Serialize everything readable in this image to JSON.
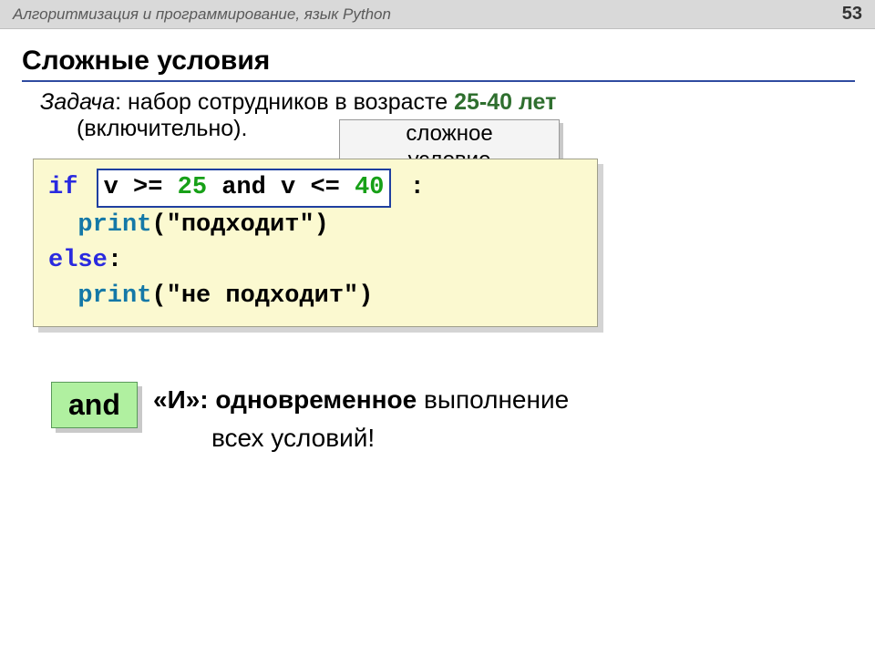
{
  "header": {
    "title": "Алгоритмизация и программирование, язык Python",
    "page": "53"
  },
  "slide_title": "Сложные условия",
  "task": {
    "label": "Задача",
    "text1": ": набор сотрудников в возрасте ",
    "ages": "25-40 лет",
    "text2": "(включительно).",
    "callout_l1": "сложное",
    "callout_l2": "условие"
  },
  "code": {
    "kw_if": "if",
    "cond": {
      "pre": "v >= ",
      "n1": "25",
      "mid": " and v <= ",
      "n2": "40"
    },
    "colon": ":",
    "fn_print1": "print",
    "str1": "(\"подходит\")",
    "kw_else": "else",
    "fn_print2": "print",
    "str2": "(\"не подходит\")"
  },
  "and_box": "and",
  "explain": {
    "line1a": "«И»:",
    "line1b": " одновременное",
    "line1c": " выполнение",
    "line2": "всех условий!"
  }
}
